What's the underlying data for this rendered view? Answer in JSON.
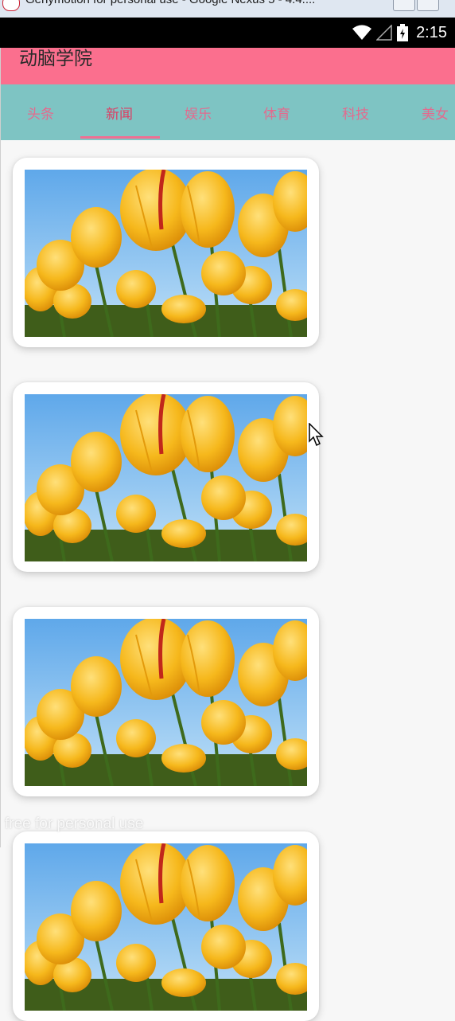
{
  "window": {
    "title": "Genymotion for personal use - Google Nexus 5 - 4.4...."
  },
  "statusbar": {
    "time": "2:15",
    "icons": [
      "wifi-icon",
      "signal-icon",
      "battery-icon"
    ]
  },
  "toolbar": {
    "title": "动脑学院",
    "color": "#fb6f8e"
  },
  "tabs": {
    "color": "#7ec4c3",
    "indicator_color": "#ef6f93",
    "active_index": 1,
    "items": [
      {
        "label": "头条"
      },
      {
        "label": "新闻"
      },
      {
        "label": "娱乐"
      },
      {
        "label": "体育"
      },
      {
        "label": "科技"
      },
      {
        "label": "美女"
      }
    ]
  },
  "cards": [
    {
      "image": "yellow-tulips-photo"
    },
    {
      "image": "yellow-tulips-photo"
    },
    {
      "image": "yellow-tulips-photo"
    },
    {
      "image": "yellow-tulips-photo"
    }
  ],
  "watermark": "free for personal use"
}
